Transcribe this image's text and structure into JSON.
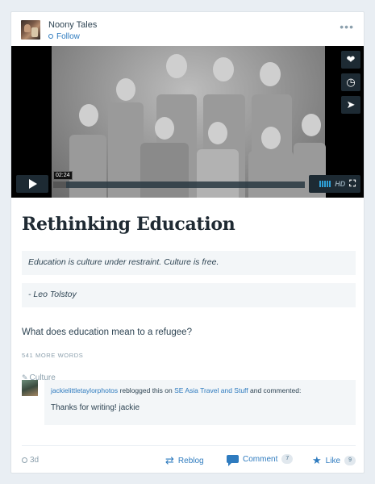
{
  "header": {
    "site_name": "Noony Tales",
    "follow_label": "Follow",
    "more_glyph": "•••"
  },
  "video": {
    "time_label": "02:24",
    "progress_fraction": 0.05,
    "hd_label": "HD",
    "side_actions": [
      {
        "icon": "heart-icon",
        "glyph": "❤"
      },
      {
        "icon": "clock-icon",
        "glyph": "◷"
      },
      {
        "icon": "send-icon",
        "glyph": "➤"
      }
    ]
  },
  "post": {
    "title": "Rethinking Education",
    "quote_1": "Education is culture under restraint.  Culture is free.",
    "quote_2": "- Leo Tolstoy",
    "paragraph": "What does education mean to a refugee?",
    "more_words": "541 MORE WORDS",
    "tag": "Culture"
  },
  "reblog_comment": {
    "user": "jackielittletaylorphotos",
    "reblogged_text": " reblogged this on ",
    "site": "SE Asia Travel and Stuff",
    "commented_text": " and commented:",
    "text": "Thanks for writing! jackie"
  },
  "footer": {
    "age": "3d",
    "reblog_label": "Reblog",
    "comment_label": "Comment",
    "comment_count": "7",
    "like_label": "Like",
    "like_count": "9"
  },
  "colors": {
    "accent": "#2e7bbf",
    "text": "#2e4453",
    "muted": "#8ca0ad",
    "background": "#e9eef3"
  }
}
